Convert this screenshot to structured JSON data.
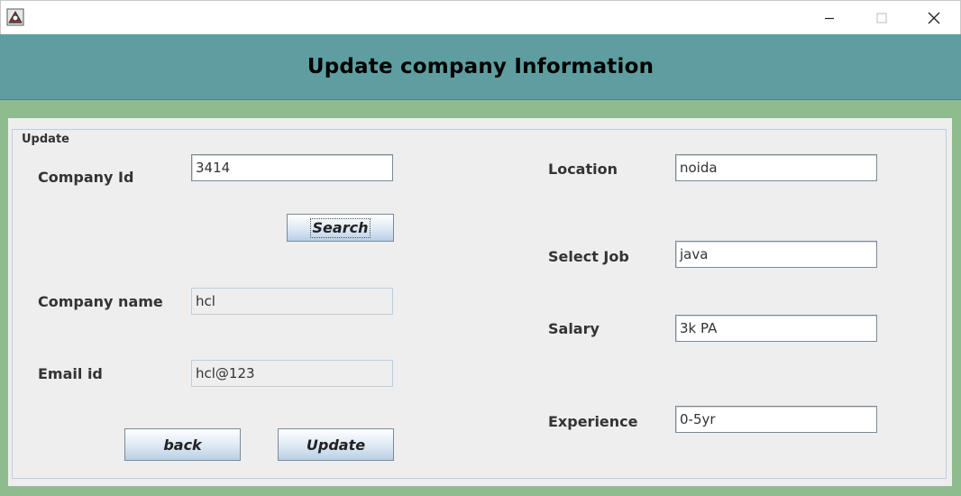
{
  "window": {
    "icons": {
      "app": "java-app-icon",
      "minimize": "minimize-icon",
      "maximize": "maximize-icon",
      "close": "close-icon"
    }
  },
  "header": {
    "title": "Update company Information"
  },
  "form": {
    "group_title": "Update",
    "company_id": {
      "label": "Company Id",
      "value": "3414"
    },
    "search_button": "Search",
    "company_name": {
      "label": "Company name",
      "value": "hcl"
    },
    "email_id": {
      "label": "Email id",
      "value": "hcl@123"
    },
    "back_button": "back",
    "update_button": "Update",
    "location": {
      "label": "Location",
      "value": "noida"
    },
    "select_job": {
      "label": "Select Job",
      "value": "java"
    },
    "salary": {
      "label": "Salary",
      "value": "3k PA"
    },
    "experience": {
      "label": "Experience",
      "value": "0-5yr"
    }
  },
  "colors": {
    "background": "#8fbc8f",
    "header": "#5f9ea0",
    "panel": "#eeeeee"
  }
}
